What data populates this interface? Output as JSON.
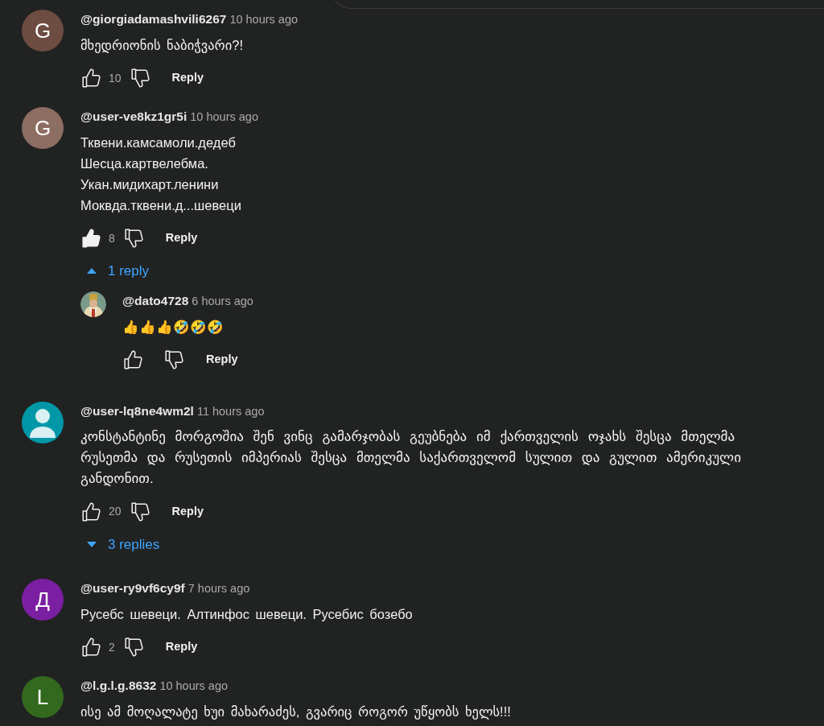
{
  "comments": [
    {
      "avatar": {
        "kind": "letter",
        "letter": "G",
        "color": "#6d4c41"
      },
      "author": "@giorgiadamashvili6267",
      "time": "10 hours ago",
      "lines": [
        "მხედრიონის ნაბიჭვარი?!"
      ],
      "likes": "10",
      "liked": false,
      "reply_label": "Reply"
    },
    {
      "avatar": {
        "kind": "letter",
        "letter": "G",
        "color": "#8d6e63"
      },
      "author": "@user-ve8kz1gr5i",
      "time": "10 hours ago",
      "lines": [
        "Тквени.камсамоли.дедеб",
        "Шесца.картвелебма.",
        "Укан.мидихарт.ленини",
        "Моквда.тквени.д...шевеци"
      ],
      "likes": "8",
      "liked": true,
      "reply_label": "Reply",
      "replies_toggle": {
        "label": "1 reply",
        "expanded": true
      },
      "replies": [
        {
          "author": "@dato4728",
          "time": "6 hours ago",
          "lines": [
            "👍👍👍🤣🤣🤣"
          ],
          "liked": false,
          "reply_label": "Reply"
        }
      ]
    },
    {
      "avatar": {
        "kind": "person",
        "color": "#0097a7"
      },
      "author": "@user-lq8ne4wm2l",
      "time": "11 hours ago",
      "lines": [
        "კონსტანტინე მორგოშია შენ ვინც გამარჯობას გეუბნება იმ ქართველის ოჯახს შესცა მთელმა რუსეთმა და რუსეთის იმპერიას შესცა მთელმა საქართველომ სულით და გულით ამერიკული განდონით."
      ],
      "likes": "20",
      "liked": false,
      "reply_label": "Reply",
      "replies_toggle": {
        "label": "3 replies",
        "expanded": false
      }
    },
    {
      "avatar": {
        "kind": "letter",
        "letter": "Д",
        "color": "#7b1fa2"
      },
      "author": "@user-ry9vf6cy9f",
      "time": "7 hours ago",
      "lines": [
        "Русебс шевеци. Алтинфос шевеци. Русебис бозебо"
      ],
      "likes": "2",
      "liked": false,
      "reply_label": "Reply"
    },
    {
      "avatar": {
        "kind": "letter",
        "letter": "L",
        "color": "#33691e"
      },
      "author": "@l.g.l.g.8632",
      "time": "10 hours ago",
      "lines": [
        "ისე ამ მოღალატე ხუი მახარაძეს, გვარიც როგორ უწყობს ხელს!!!"
      ]
    }
  ]
}
